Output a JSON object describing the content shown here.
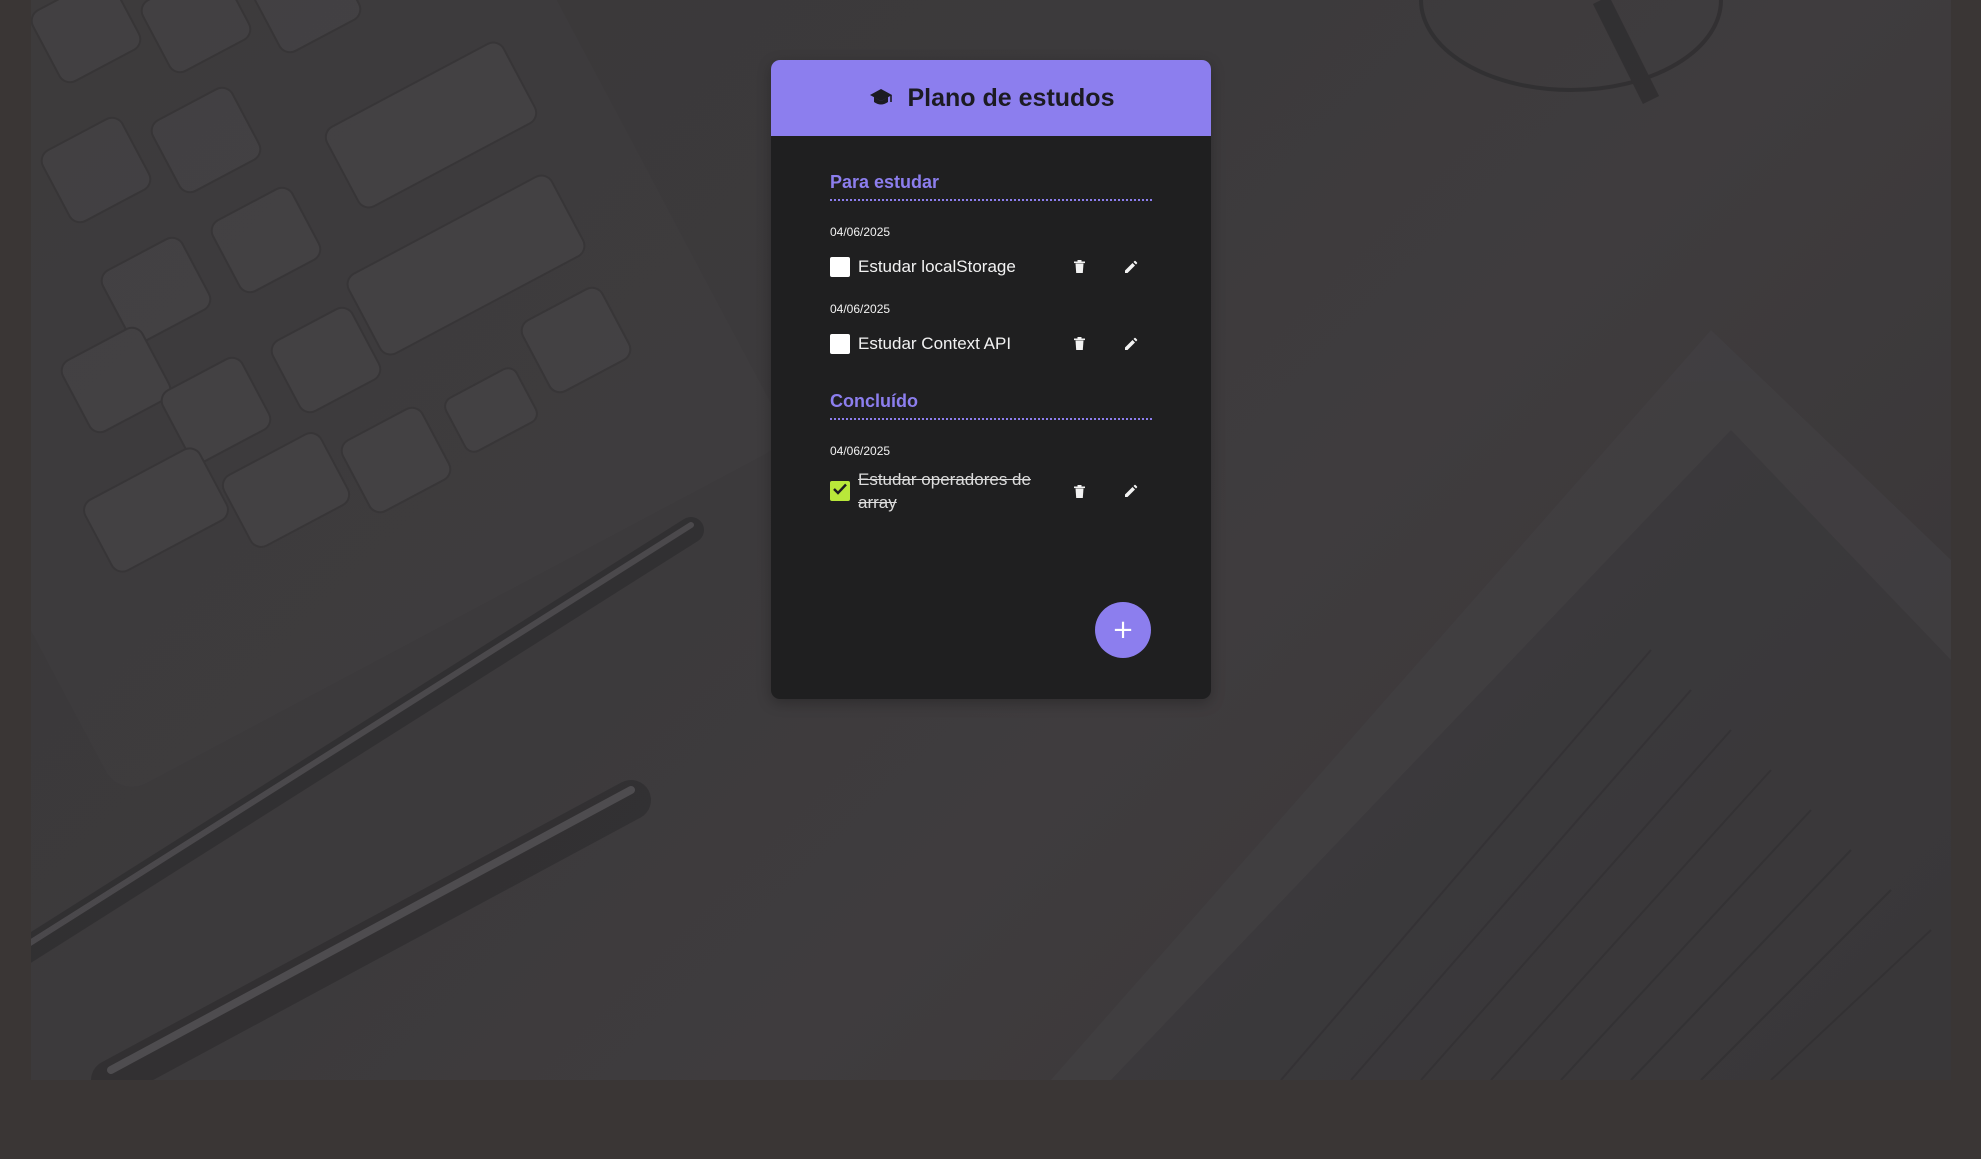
{
  "app": {
    "title": "Plano de estudos",
    "accent_color": "#8c7eee",
    "header_icon": "graduation-cap-icon"
  },
  "sections": [
    {
      "title": "Para estudar",
      "tasks": [
        {
          "date": "04/06/2025",
          "label": "Estudar localStorage",
          "done": false
        },
        {
          "date": "04/06/2025",
          "label": "Estudar Context API",
          "done": false
        }
      ]
    },
    {
      "title": "Concluído",
      "tasks": [
        {
          "date": "04/06/2025",
          "label": "Estudar operadores de array",
          "done": true
        }
      ]
    }
  ],
  "add_button": {
    "label": "+",
    "icon": "plus-icon"
  },
  "icons": {
    "delete": "trash-icon",
    "edit": "pencil-icon",
    "checked": "check-icon"
  },
  "colors": {
    "checked_box": "#b9e83a",
    "card_bg": "#1f1f20",
    "header_bg": "#8c7eee"
  }
}
